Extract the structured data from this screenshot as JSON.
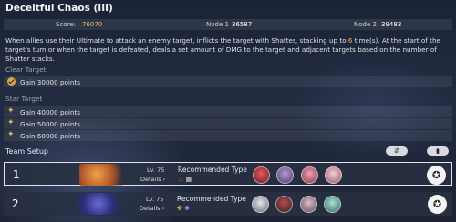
{
  "title": "Deceitful Chaos (III)",
  "score_strip": {
    "score_label": "Score:",
    "score_value": "76070",
    "node1_label": "Node 1",
    "node1_value": "36587",
    "node2_label": "Node 2",
    "node2_value": "39483"
  },
  "description": {
    "part1": "When allies use their Ultimate to attack an enemy target, inflicts the target with Shatter, stacking up to ",
    "highlight": "6",
    "part2": " time(s). At the start of the target's turn or when the target is defeated, deals a set amount of DMG to the target and adjacent targets based on the number of Shatter stacks."
  },
  "clear_target": {
    "label": "Clear Target",
    "items": [
      "Gain 30000 points"
    ]
  },
  "star_target": {
    "label": "Star Target",
    "items": [
      "Gain 40000 points",
      "Gain 50000 points",
      "Gain 60000 points"
    ]
  },
  "team_setup": {
    "label": "Team Setup",
    "button1": "⇵",
    "button2": "▮",
    "teams": [
      {
        "number": "1",
        "level": "Lv. 75",
        "details": "Details",
        "recommended_label": "Recommended Type",
        "types": [
          "fire-icon",
          "quantum-icon"
        ],
        "start_icon": "play-star-icon"
      },
      {
        "number": "2",
        "level": "Lv. 75",
        "details": "Details",
        "recommended_label": "Recommended Type",
        "types": [
          "imaginary-icon",
          "lightning-icon"
        ],
        "start_icon": "play-star-icon"
      }
    ]
  },
  "colors": {
    "highlight": "#f0b24a",
    "gold": "#e0b766",
    "accent_fire": "#e0523a",
    "accent_quantum": "#7a6cd8"
  }
}
